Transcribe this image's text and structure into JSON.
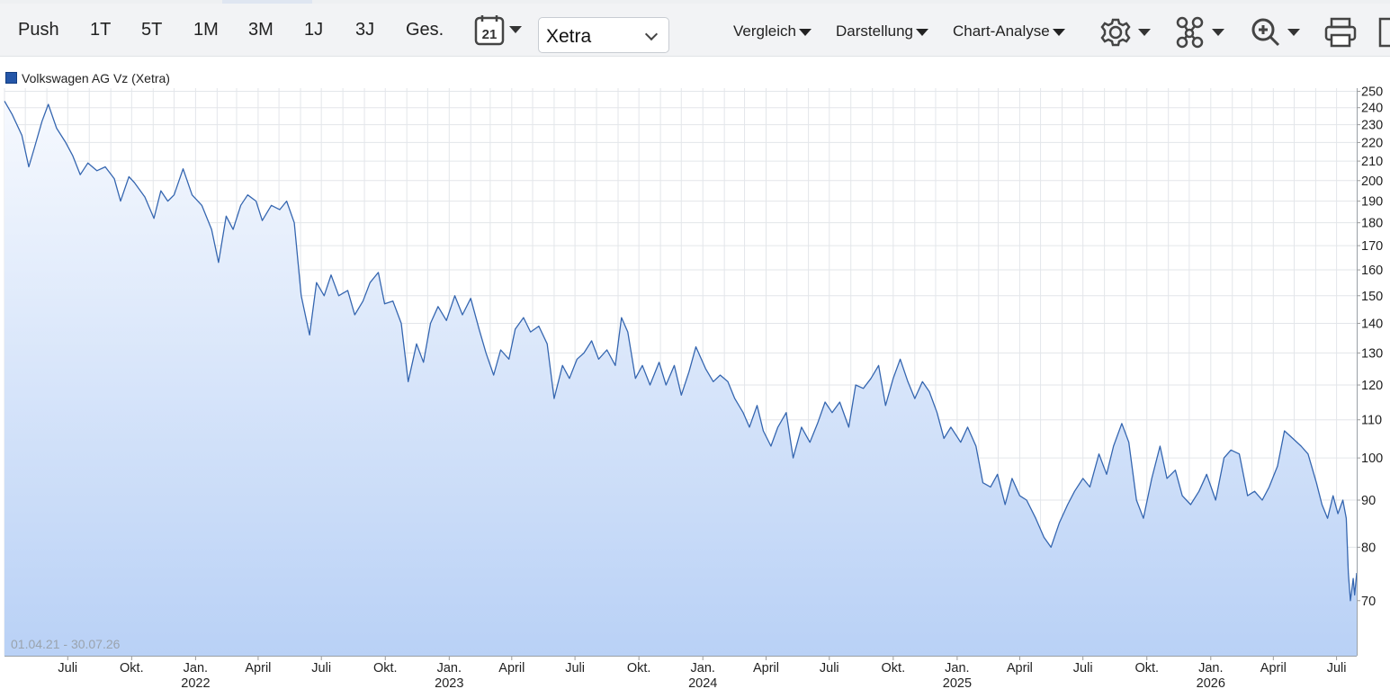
{
  "toolbar": {
    "periods": [
      "Push",
      "1T",
      "5T",
      "1M",
      "3M",
      "1J",
      "3J",
      "Ges."
    ],
    "calendar_day": "21",
    "exchange": "Xetra",
    "menus": [
      "Vergleich",
      "Darstellung",
      "Chart-Analyse"
    ],
    "icons": [
      "settings-icon",
      "network-icon",
      "zoom-icon",
      "print-icon",
      "bookmark-icon"
    ]
  },
  "legend": {
    "label": "Volkswagen AG Vz (Xetra)",
    "color": "#2456a8"
  },
  "date_range": "01.04.21 - 30.07.26",
  "chart_data": {
    "type": "area",
    "series": [
      {
        "name": "Volkswagen AG Vz (Xetra)",
        "color": "#3566b0"
      }
    ],
    "x_range": [
      "2021-04-01",
      "2026-07-30"
    ],
    "y_ticks": [
      70,
      80,
      90,
      100,
      110,
      120,
      130,
      140,
      150,
      160,
      170,
      180,
      190,
      200,
      210,
      220,
      230,
      240,
      250
    ],
    "ylim": [
      61,
      252
    ],
    "y_scale": "log",
    "grid": true,
    "x_tick_labels": [
      {
        "d": "2021-07-01",
        "label": "Juli",
        "year": ""
      },
      {
        "d": "2021-10-01",
        "label": "Okt.",
        "year": ""
      },
      {
        "d": "2022-01-01",
        "label": "Jan.",
        "year": "2022"
      },
      {
        "d": "2022-04-01",
        "label": "April",
        "year": ""
      },
      {
        "d": "2022-07-01",
        "label": "Juli",
        "year": ""
      },
      {
        "d": "2022-10-01",
        "label": "Okt.",
        "year": ""
      },
      {
        "d": "2023-01-01",
        "label": "Jan.",
        "year": "2023"
      },
      {
        "d": "2023-04-01",
        "label": "April",
        "year": ""
      },
      {
        "d": "2023-07-01",
        "label": "Juli",
        "year": ""
      },
      {
        "d": "2023-10-01",
        "label": "Okt.",
        "year": ""
      },
      {
        "d": "2024-01-01",
        "label": "Jan.",
        "year": "2024"
      },
      {
        "d": "2024-04-01",
        "label": "April",
        "year": ""
      },
      {
        "d": "2024-07-01",
        "label": "Juli",
        "year": ""
      },
      {
        "d": "2024-10-01",
        "label": "Okt.",
        "year": ""
      },
      {
        "d": "2025-01-01",
        "label": "Jan.",
        "year": "2025"
      },
      {
        "d": "2025-04-01",
        "label": "April",
        "year": ""
      },
      {
        "d": "2025-07-01",
        "label": "Juli",
        "year": ""
      },
      {
        "d": "2025-10-01",
        "label": "Okt.",
        "year": ""
      },
      {
        "d": "2026-01-01",
        "label": "Jan.",
        "year": "2026"
      },
      {
        "d": "2026-04-01",
        "label": "April",
        "year": ""
      },
      {
        "d": "2026-07-01",
        "label": "Juli",
        "year": ""
      }
    ],
    "points": [
      [
        "2021-04-01",
        244
      ],
      [
        "2021-04-12",
        236
      ],
      [
        "2021-04-26",
        224
      ],
      [
        "2021-05-06",
        207
      ],
      [
        "2021-05-14",
        217
      ],
      [
        "2021-05-25",
        232
      ],
      [
        "2021-06-03",
        242
      ],
      [
        "2021-06-15",
        228
      ],
      [
        "2021-06-28",
        220
      ],
      [
        "2021-07-08",
        213
      ],
      [
        "2021-07-19",
        203
      ],
      [
        "2021-07-30",
        209
      ],
      [
        "2021-08-12",
        205
      ],
      [
        "2021-08-24",
        207
      ],
      [
        "2021-09-06",
        201
      ],
      [
        "2021-09-15",
        190
      ],
      [
        "2021-09-27",
        202
      ],
      [
        "2021-10-05",
        199
      ],
      [
        "2021-10-20",
        192
      ],
      [
        "2021-11-02",
        182
      ],
      [
        "2021-11-12",
        195
      ],
      [
        "2021-11-22",
        190
      ],
      [
        "2021-12-01",
        193
      ],
      [
        "2021-12-14",
        206
      ],
      [
        "2021-12-27",
        193
      ],
      [
        "2022-01-10",
        188
      ],
      [
        "2022-01-24",
        177
      ],
      [
        "2022-02-03",
        163
      ],
      [
        "2022-02-14",
        183
      ],
      [
        "2022-02-24",
        177
      ],
      [
        "2022-03-07",
        188
      ],
      [
        "2022-03-17",
        193
      ],
      [
        "2022-03-29",
        190
      ],
      [
        "2022-04-07",
        181
      ],
      [
        "2022-04-20",
        188
      ],
      [
        "2022-05-02",
        186
      ],
      [
        "2022-05-12",
        190
      ],
      [
        "2022-05-23",
        180
      ],
      [
        "2022-06-02",
        150
      ],
      [
        "2022-06-14",
        136
      ],
      [
        "2022-06-24",
        155
      ],
      [
        "2022-07-05",
        150
      ],
      [
        "2022-07-15",
        158
      ],
      [
        "2022-07-26",
        150
      ],
      [
        "2022-08-08",
        152
      ],
      [
        "2022-08-18",
        143
      ],
      [
        "2022-08-30",
        148
      ],
      [
        "2022-09-09",
        155
      ],
      [
        "2022-09-21",
        159
      ],
      [
        "2022-09-30",
        147
      ],
      [
        "2022-10-12",
        148
      ],
      [
        "2022-10-24",
        140
      ],
      [
        "2022-11-03",
        121
      ],
      [
        "2022-11-15",
        133
      ],
      [
        "2022-11-25",
        127
      ],
      [
        "2022-12-05",
        140
      ],
      [
        "2022-12-16",
        146
      ],
      [
        "2022-12-28",
        141
      ],
      [
        "2023-01-09",
        150
      ],
      [
        "2023-01-20",
        143
      ],
      [
        "2023-02-01",
        149
      ],
      [
        "2023-02-13",
        138
      ],
      [
        "2023-02-23",
        130
      ],
      [
        "2023-03-06",
        123
      ],
      [
        "2023-03-16",
        131
      ],
      [
        "2023-03-28",
        128
      ],
      [
        "2023-04-06",
        138
      ],
      [
        "2023-04-18",
        142
      ],
      [
        "2023-04-28",
        137
      ],
      [
        "2023-05-10",
        139
      ],
      [
        "2023-05-22",
        133
      ],
      [
        "2023-06-01",
        116
      ],
      [
        "2023-06-13",
        126
      ],
      [
        "2023-06-23",
        122
      ],
      [
        "2023-07-04",
        128
      ],
      [
        "2023-07-14",
        130
      ],
      [
        "2023-07-25",
        134
      ],
      [
        "2023-08-04",
        128
      ],
      [
        "2023-08-16",
        131
      ],
      [
        "2023-08-28",
        126
      ],
      [
        "2023-09-06",
        142
      ],
      [
        "2023-09-15",
        137
      ],
      [
        "2023-09-26",
        122
      ],
      [
        "2023-10-06",
        126
      ],
      [
        "2023-10-17",
        120
      ],
      [
        "2023-10-30",
        127
      ],
      [
        "2023-11-09",
        120
      ],
      [
        "2023-11-21",
        126
      ],
      [
        "2023-12-01",
        117
      ],
      [
        "2023-12-12",
        124
      ],
      [
        "2023-12-22",
        132
      ],
      [
        "2024-01-05",
        125
      ],
      [
        "2024-01-16",
        121
      ],
      [
        "2024-01-26",
        123
      ],
      [
        "2024-02-06",
        121
      ],
      [
        "2024-02-16",
        116
      ],
      [
        "2024-02-28",
        112
      ],
      [
        "2024-03-08",
        108
      ],
      [
        "2024-03-19",
        114
      ],
      [
        "2024-03-28",
        107
      ],
      [
        "2024-04-08",
        103
      ],
      [
        "2024-04-18",
        108
      ],
      [
        "2024-04-30",
        112
      ],
      [
        "2024-05-10",
        100
      ],
      [
        "2024-05-22",
        108
      ],
      [
        "2024-06-03",
        104
      ],
      [
        "2024-06-14",
        109
      ],
      [
        "2024-06-25",
        115
      ],
      [
        "2024-07-05",
        112
      ],
      [
        "2024-07-16",
        115
      ],
      [
        "2024-07-29",
        108
      ],
      [
        "2024-08-08",
        120
      ],
      [
        "2024-08-19",
        119
      ],
      [
        "2024-08-30",
        122
      ],
      [
        "2024-09-10",
        126
      ],
      [
        "2024-09-20",
        114
      ],
      [
        "2024-10-01",
        122
      ],
      [
        "2024-10-11",
        128
      ],
      [
        "2024-10-22",
        121
      ],
      [
        "2024-11-01",
        116
      ],
      [
        "2024-11-12",
        121
      ],
      [
        "2024-11-22",
        118
      ],
      [
        "2024-12-03",
        112
      ],
      [
        "2024-12-13",
        105
      ],
      [
        "2024-12-23",
        108
      ],
      [
        "2025-01-06",
        104
      ],
      [
        "2025-01-16",
        108
      ],
      [
        "2025-01-28",
        103
      ],
      [
        "2025-02-07",
        94
      ],
      [
        "2025-02-18",
        93
      ],
      [
        "2025-02-28",
        96
      ],
      [
        "2025-03-11",
        89
      ],
      [
        "2025-03-21",
        95
      ],
      [
        "2025-04-01",
        91
      ],
      [
        "2025-04-11",
        90
      ],
      [
        "2025-04-24",
        86
      ],
      [
        "2025-05-06",
        82
      ],
      [
        "2025-05-16",
        80
      ],
      [
        "2025-05-28",
        85
      ],
      [
        "2025-06-09",
        89
      ],
      [
        "2025-06-19",
        92
      ],
      [
        "2025-07-01",
        95
      ],
      [
        "2025-07-11",
        93
      ],
      [
        "2025-07-24",
        101
      ],
      [
        "2025-08-04",
        96
      ],
      [
        "2025-08-14",
        103
      ],
      [
        "2025-08-26",
        109
      ],
      [
        "2025-09-05",
        104
      ],
      [
        "2025-09-16",
        90
      ],
      [
        "2025-09-26",
        86
      ],
      [
        "2025-10-08",
        95
      ],
      [
        "2025-10-20",
        103
      ],
      [
        "2025-10-30",
        95
      ],
      [
        "2025-11-11",
        97
      ],
      [
        "2025-11-21",
        91
      ],
      [
        "2025-12-03",
        89
      ],
      [
        "2025-12-15",
        92
      ],
      [
        "2025-12-26",
        96
      ],
      [
        "2026-01-08",
        90
      ],
      [
        "2026-01-20",
        100
      ],
      [
        "2026-01-30",
        102
      ],
      [
        "2026-02-11",
        101
      ],
      [
        "2026-02-23",
        91
      ],
      [
        "2026-03-05",
        92
      ],
      [
        "2026-03-16",
        90
      ],
      [
        "2026-03-26",
        93
      ],
      [
        "2026-04-07",
        98
      ],
      [
        "2026-04-17",
        107
      ],
      [
        "2026-04-29",
        105
      ],
      [
        "2026-05-11",
        103
      ],
      [
        "2026-05-21",
        101
      ],
      [
        "2026-06-02",
        94
      ],
      [
        "2026-06-10",
        89
      ],
      [
        "2026-06-18",
        86
      ],
      [
        "2026-06-26",
        91
      ],
      [
        "2026-07-03",
        87
      ],
      [
        "2026-07-10",
        90
      ],
      [
        "2026-07-15",
        86
      ],
      [
        "2026-07-18",
        75
      ],
      [
        "2026-07-21",
        70
      ],
      [
        "2026-07-23",
        72
      ],
      [
        "2026-07-25",
        74
      ],
      [
        "2026-07-27",
        71
      ],
      [
        "2026-07-30",
        75
      ]
    ]
  }
}
